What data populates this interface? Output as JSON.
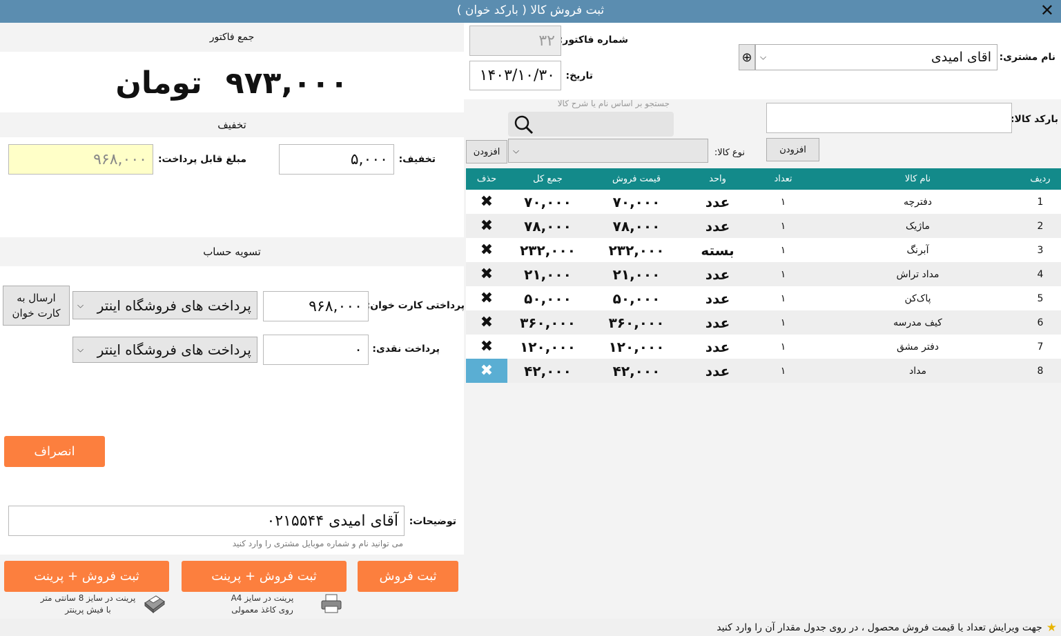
{
  "window": {
    "title": "ثبت فروش کالا ( بارکد خوان )",
    "close": "✕"
  },
  "invoice": {
    "customer_label": "نام مشتری:",
    "customer_value": "اقای امیدی",
    "add_customer": "⊕",
    "number_label": "شماره فاکتور:",
    "number_value": "۳۲",
    "date_label": "تاریخ:",
    "date_value": "۱۴۰۳/۱۰/۳۰"
  },
  "product_entry": {
    "search_placeholder": "جستجو بر اساس نام یا شرح کالا",
    "barcode_label": "بارکد کالا:",
    "barcode_value": "",
    "add_label": "افزودن",
    "type_label": "نوع کالا:",
    "type_value": "",
    "add_label_2": "افزودن"
  },
  "table": {
    "headers": [
      "ردیف",
      "نام کالا",
      "تعداد",
      "واحد",
      "قیمت فروش",
      "جمع کل",
      "حذف"
    ],
    "rows": [
      {
        "row": "1",
        "name": "دفترچه",
        "qty": "۱",
        "unit": "عدد",
        "price": "۷۰,۰۰۰",
        "total": "۷۰,۰۰۰",
        "del": "✖"
      },
      {
        "row": "2",
        "name": "ماژیک",
        "qty": "۱",
        "unit": "عدد",
        "price": "۷۸,۰۰۰",
        "total": "۷۸,۰۰۰",
        "del": "✖"
      },
      {
        "row": "3",
        "name": "آبرنگ",
        "qty": "۱",
        "unit": "بسته",
        "price": "۲۳۲,۰۰۰",
        "total": "۲۳۲,۰۰۰",
        "del": "✖"
      },
      {
        "row": "4",
        "name": "مداد تراش",
        "qty": "۱",
        "unit": "عدد",
        "price": "۲۱,۰۰۰",
        "total": "۲۱,۰۰۰",
        "del": "✖"
      },
      {
        "row": "5",
        "name": "پاک‌کن",
        "qty": "۱",
        "unit": "عدد",
        "price": "۵۰,۰۰۰",
        "total": "۵۰,۰۰۰",
        "del": "✖"
      },
      {
        "row": "6",
        "name": "کیف مدرسه",
        "qty": "۱",
        "unit": "عدد",
        "price": "۳۶۰,۰۰۰",
        "total": "۳۶۰,۰۰۰",
        "del": "✖"
      },
      {
        "row": "7",
        "name": "دفتر مشق",
        "qty": "۱",
        "unit": "عدد",
        "price": "۱۲۰,۰۰۰",
        "total": "۱۲۰,۰۰۰",
        "del": "✖"
      },
      {
        "row": "8",
        "name": "مداد",
        "qty": "۱",
        "unit": "عدد",
        "price": "۴۲,۰۰۰",
        "total": "۴۲,۰۰۰",
        "del": "✖"
      }
    ],
    "selected_row": 8
  },
  "summary": {
    "total_header": "جمع فاکتور",
    "total_amount": "۹۷۳,۰۰۰",
    "currency": "تومان",
    "discount_header": "تخفیف",
    "discount_label": "تخفیف:",
    "discount_value": "۵,۰۰۰",
    "payable_label": "مبلغ قابل پرداخت:",
    "payable_value": "۹۶۸,۰۰۰"
  },
  "settlement": {
    "header": "تسویه حساب",
    "card_label": "پرداختی کارت خوان:",
    "card_value": "۹۶۸,۰۰۰",
    "card_account": "پرداخت های فروشگاه اینتر",
    "send_to_reader": "ارسال به کارت خوان",
    "cash_label": "پرداخت نقدی:",
    "cash_value": "۰",
    "cash_account": "پرداخت های فروشگاه اینتر"
  },
  "actions": {
    "cancel": "انصراف",
    "notes_label": "توضیحات:",
    "notes_value": "آقای امیدی ۰۲۱۵۵۴۴",
    "notes_hint": "می توانید نام و شماره موبایل مشتری را وارد کنید",
    "save": "ثبت فروش",
    "save_print_a4": "ثبت فروش + پرینت",
    "save_print_a4_hint_1": "پرینت در سایز A4",
    "save_print_a4_hint_2": "روی کاغذ معمولی",
    "save_print_receipt": "ثبت فروش + پرینت",
    "save_print_receipt_hint_1": "پرینت در سایز 8 سانتی متر",
    "save_print_receipt_hint_2": "با فیش پرینتر"
  },
  "status": {
    "icon": "star-icon",
    "text": "جهت ویرایش تعداد یا قیمت فروش محصول ، در روی جدول مقدار آن را وارد کنید"
  },
  "colors": {
    "titlebar": "#5b8db0",
    "table_header": "#138a8a",
    "accent": "#fc7f3e",
    "selected_delete": "#5aaed3",
    "payable_bg": "#ffffc8"
  }
}
